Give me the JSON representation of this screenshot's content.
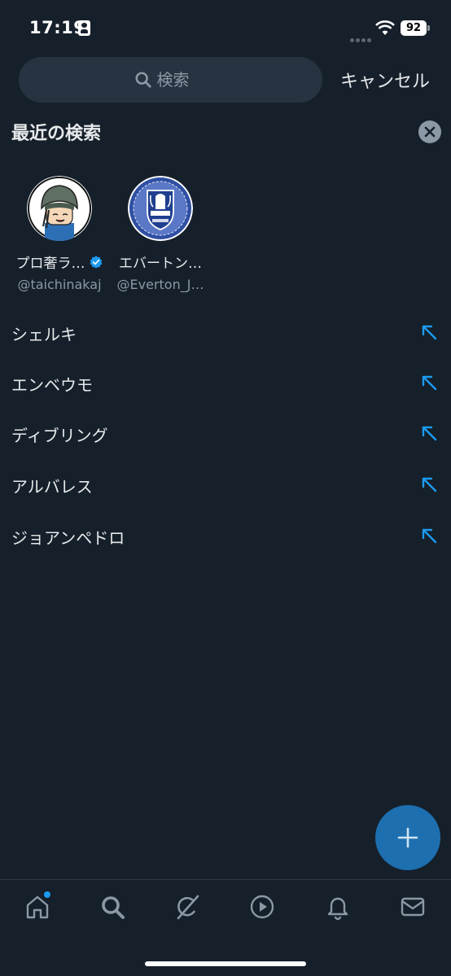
{
  "status_bar": {
    "time": "17:19",
    "battery": "92"
  },
  "search": {
    "placeholder": "検索",
    "cancel_label": "キャンセル"
  },
  "recent": {
    "title": "最近の検索",
    "accounts": [
      {
        "name": "プロ奢ラ…",
        "handle": "@taichinakaj",
        "verified": true
      },
      {
        "name": "エバートン…",
        "handle": "@Everton_J…",
        "verified": false
      }
    ],
    "queries": [
      "シェルキ",
      "エンベウモ",
      "ディブリング",
      "アルバレス",
      "ジョアンペドロ"
    ]
  },
  "colors": {
    "background": "#15202b",
    "accent": "#1d9bf0",
    "fab": "#1d6fb0",
    "muted": "#8b98a5"
  },
  "icons": {
    "tabs": [
      "home-icon",
      "search-icon",
      "grok-icon",
      "video-icon",
      "bell-icon",
      "mail-icon"
    ],
    "fab": "plus-icon",
    "query_action": "arrow-up-left-icon"
  }
}
